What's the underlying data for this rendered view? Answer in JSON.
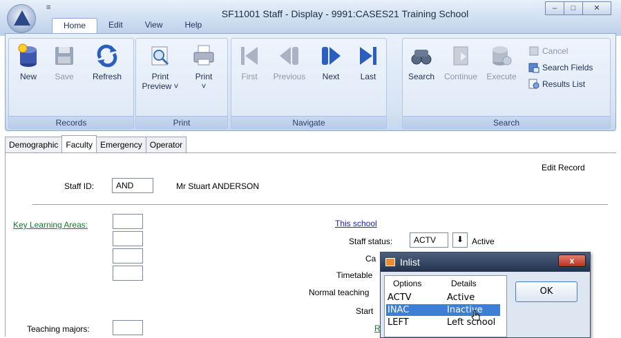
{
  "window": {
    "title": "SF11001 Staff - Display - 9991:CASES21 Training School",
    "qat_glyph": "≡",
    "min": "–",
    "max": "□",
    "close": "✕"
  },
  "tabs": [
    {
      "label": "Home",
      "active": true
    },
    {
      "label": "Edit"
    },
    {
      "label": "View"
    },
    {
      "label": "Help"
    }
  ],
  "ribbon": {
    "records": {
      "label": "Records",
      "new": "New",
      "save": "Save",
      "refresh": "Refresh"
    },
    "print": {
      "label": "Print",
      "print_preview": "Print",
      "print_preview2": "Preview ˅",
      "print": "Print",
      "print_arrow": "˅"
    },
    "navigate": {
      "label": "Navigate",
      "first": "First",
      "previous": "Previous",
      "next": "Next",
      "last": "Last"
    },
    "search": {
      "label": "Search",
      "search": "Search",
      "continue": "Continue",
      "execute": "Execute",
      "cancel": "Cancel",
      "search_fields": "Search Fields",
      "results_list": "Results List"
    }
  },
  "subtabs": [
    {
      "label": "Demographic"
    },
    {
      "label": "Faculty",
      "active": true
    },
    {
      "label": "Emergency"
    },
    {
      "label": "Operator"
    }
  ],
  "content": {
    "edit_record": "Edit Record",
    "staff_id_label": "Staff ID:",
    "staff_id_value": "AND",
    "staff_name": "Mr Stuart ANDERSON",
    "kla_label": "Key Learning Areas:",
    "this_school": "This school",
    "staff_status_label": "Staff status:",
    "staff_status_value": "ACTV",
    "staff_status_text": "Active",
    "car_label": "Ca",
    "timetable_label": "Timetable",
    "normal_teaching_label": "Normal teaching",
    "start_label": "Start",
    "teaching_majors_label": "Teaching majors:",
    "dropdown_glyph": "⬇",
    "partial_link": "R"
  },
  "dialog": {
    "title": "Inlist",
    "close": "x",
    "col_options": "Options",
    "col_details": "Details",
    "rows": [
      {
        "option": "ACTV",
        "detail": "Active"
      },
      {
        "option": "INAC",
        "detail": "Inactive",
        "selected": true
      },
      {
        "option": "LEFT",
        "detail": "Left school"
      }
    ],
    "ok": "OK"
  }
}
